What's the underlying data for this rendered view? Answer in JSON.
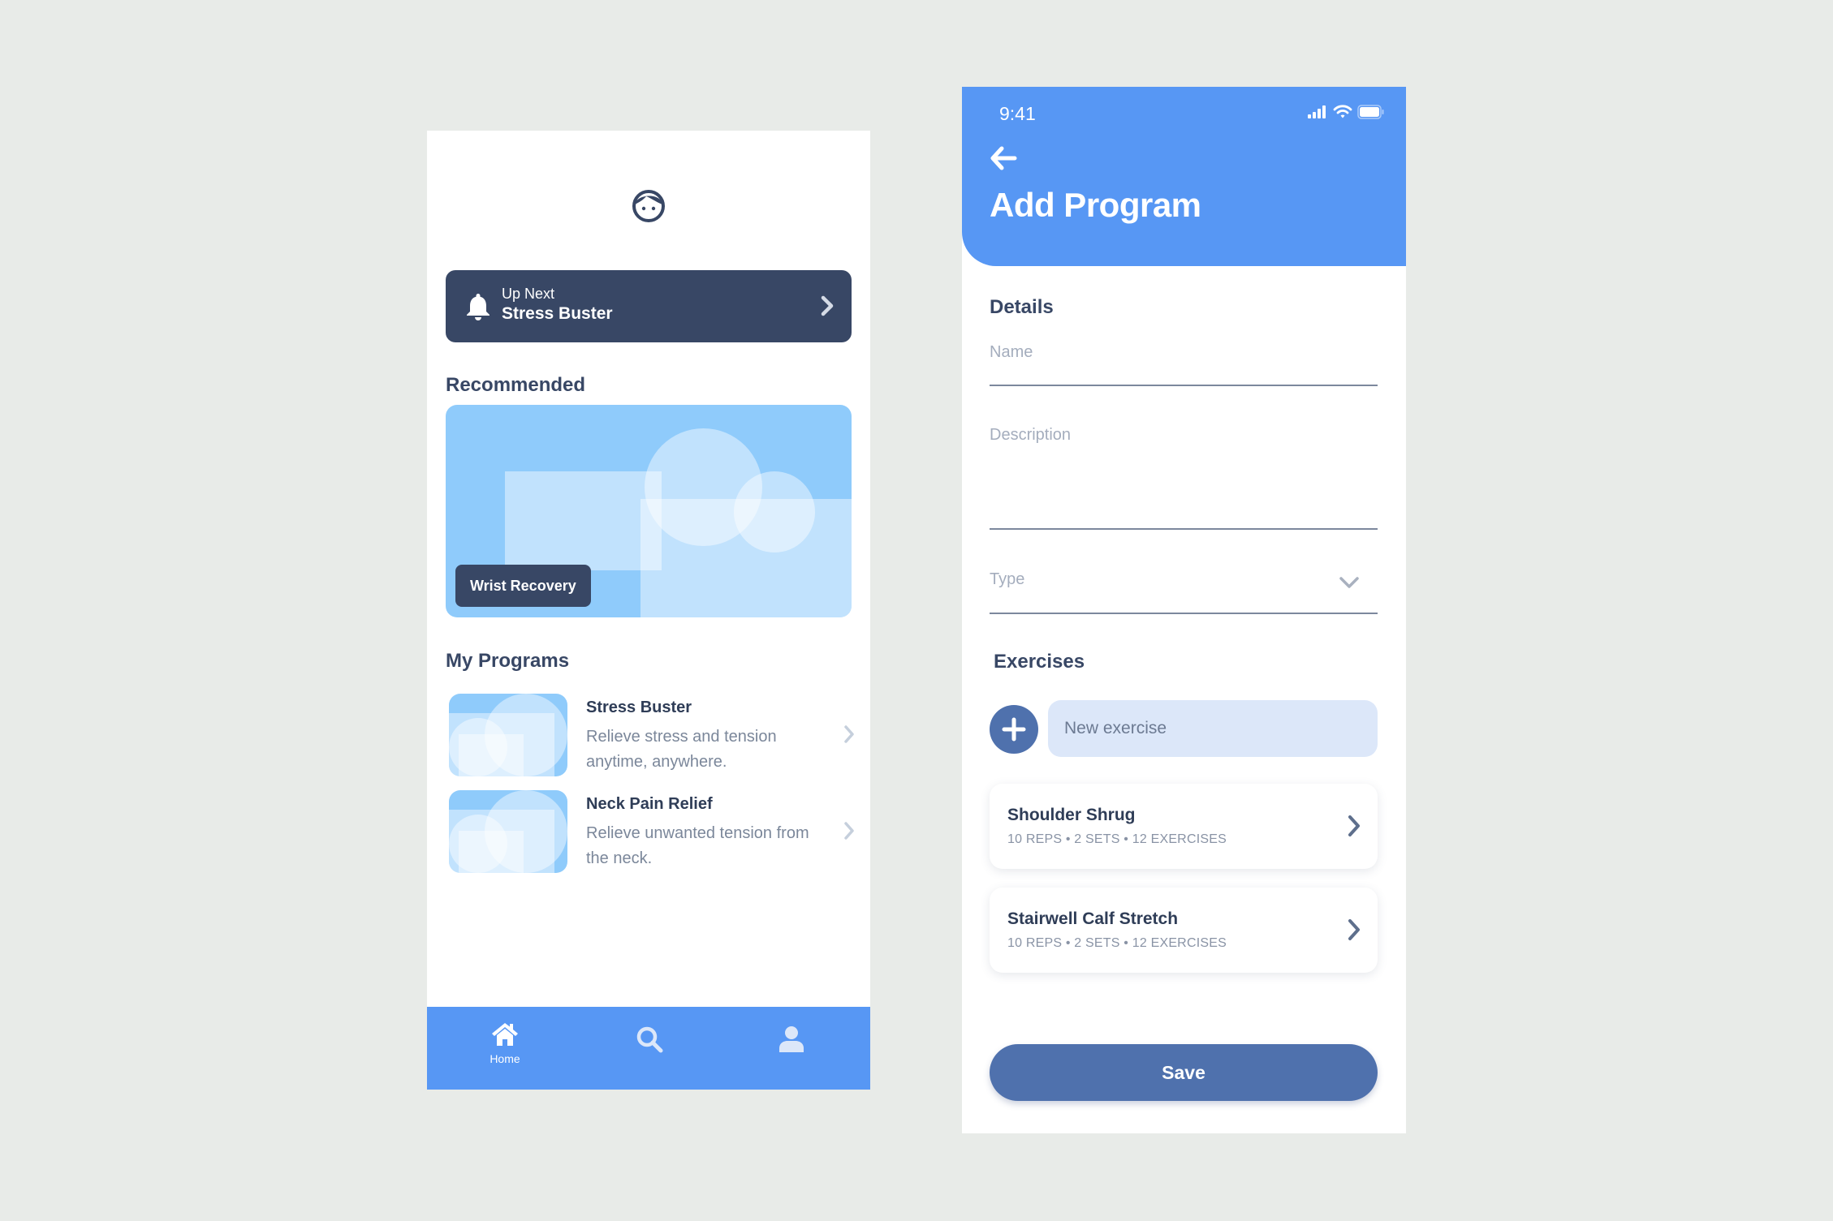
{
  "colors": {
    "background": "#e8ebe8",
    "primary_blue": "#5797f4",
    "navy": "#384765",
    "button_blue": "#4f71ad",
    "card_light_blue": "#8fcbfb",
    "input_fill": "#dce7f9"
  },
  "home": {
    "avatar_icon": "face-icon",
    "up_next": {
      "icon": "bell-icon",
      "label": "Up Next",
      "title": "Stress Buster"
    },
    "recommended": {
      "section_title": "Recommended",
      "card_label": "Wrist Recovery"
    },
    "my_programs": {
      "section_title": "My Programs",
      "items": [
        {
          "title": "Stress Buster",
          "description": "Relieve stress and tension anytime, anywhere."
        },
        {
          "title": "Neck Pain Relief",
          "description": "Relieve unwanted tension from the neck."
        }
      ]
    },
    "tabbar": {
      "tabs": [
        {
          "icon": "home-icon",
          "label": "Home",
          "active": true
        },
        {
          "icon": "search-icon",
          "label": "",
          "active": false
        },
        {
          "icon": "user-icon",
          "label": "",
          "active": false
        }
      ]
    }
  },
  "add_program": {
    "status_bar": {
      "time": "9:41"
    },
    "title": "Add Program",
    "details": {
      "section_title": "Details",
      "name_placeholder": "Name",
      "description_placeholder": "Description",
      "type_placeholder": "Type"
    },
    "exercises": {
      "section_title": "Exercises",
      "new_exercise_placeholder": "New exercise",
      "items": [
        {
          "title": "Shoulder Shrug",
          "meta": "10 REPS • 2 SETS • 12 EXERCISES"
        },
        {
          "title": "Stairwell Calf Stretch",
          "meta": "10 REPS • 2 SETS • 12 EXERCISES"
        }
      ]
    },
    "save_label": "Save"
  }
}
